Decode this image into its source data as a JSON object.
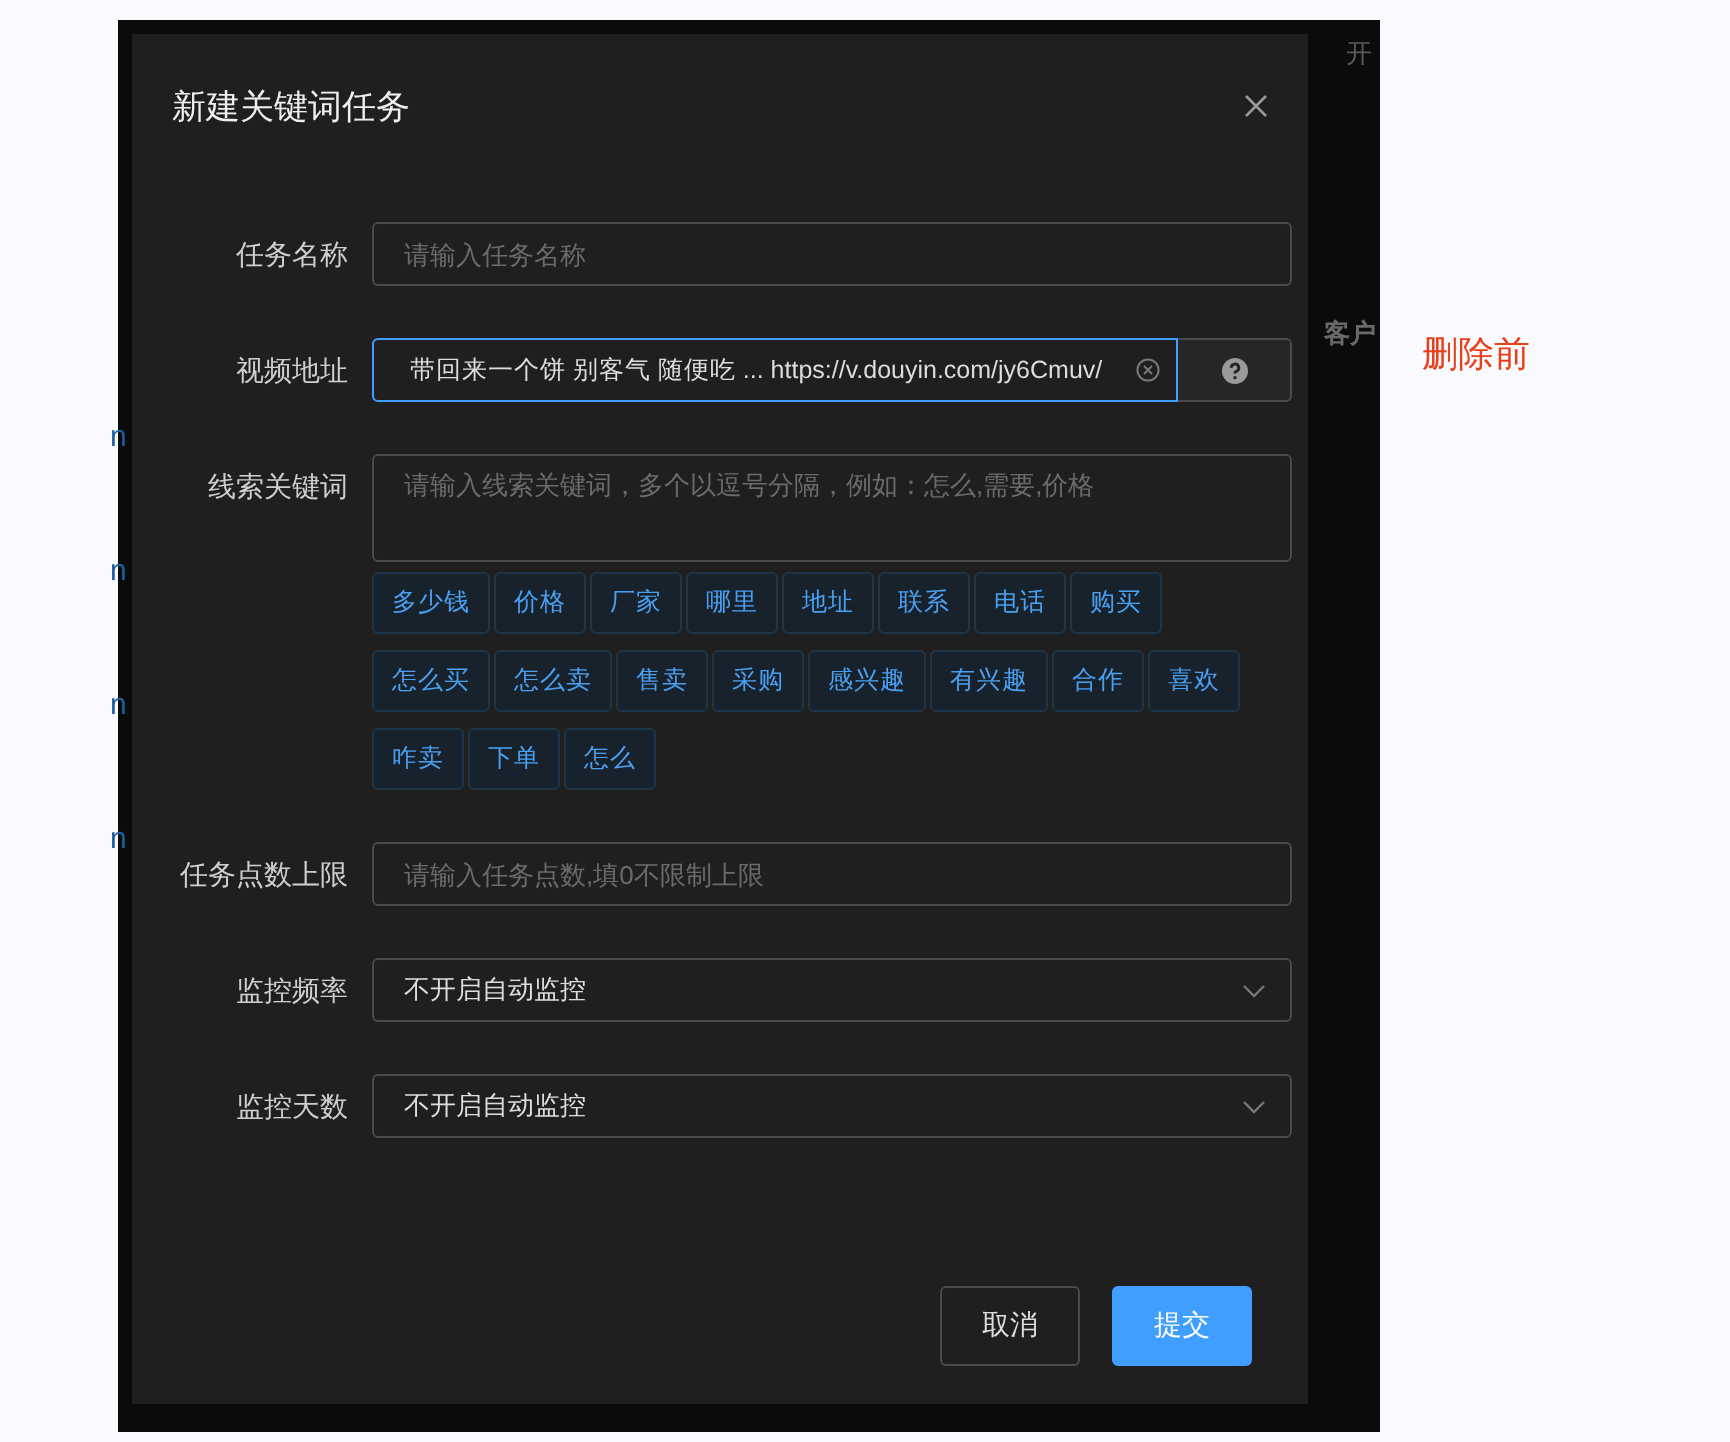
{
  "backdrop": {
    "header_text": "开",
    "cell_text": "客户",
    "row_links": [
      "n",
      "n",
      "n",
      "n"
    ]
  },
  "side_note": "删除前",
  "dialog": {
    "title": "新建关键词任务"
  },
  "fields": [
    {
      "kind": "input",
      "label": "任务名称",
      "placeholder": "请输入任务名称"
    },
    {
      "kind": "url",
      "label": "视频地址",
      "value": "带回来一个饼 别客气 随便吃 ... https://v.douyin.com/jy6Cmuv/",
      "focused": true
    },
    {
      "kind": "textarea",
      "label": "线索关键词",
      "placeholder": "请输入线索关键词，多个以逗号分隔，例如：怎么,需要,价格",
      "tags": [
        "多少钱",
        "价格",
        "厂家",
        "哪里",
        "地址",
        "联系",
        "电话",
        "购买",
        "怎么买",
        "怎么卖",
        "售卖",
        "采购",
        "感兴趣",
        "有兴趣",
        "合作",
        "喜欢",
        "咋卖",
        "下单",
        "怎么"
      ]
    },
    {
      "kind": "input",
      "label": "任务点数上限",
      "placeholder": "请输入任务点数,填0不限制上限"
    },
    {
      "kind": "select",
      "label": "监控频率",
      "value": "不开启自动监控"
    },
    {
      "kind": "select",
      "label": "监控天数",
      "value": "不开启自动监控"
    }
  ],
  "buttons": [
    {
      "label": "取消",
      "kind": "default"
    },
    {
      "label": "提交",
      "kind": "primary"
    }
  ]
}
